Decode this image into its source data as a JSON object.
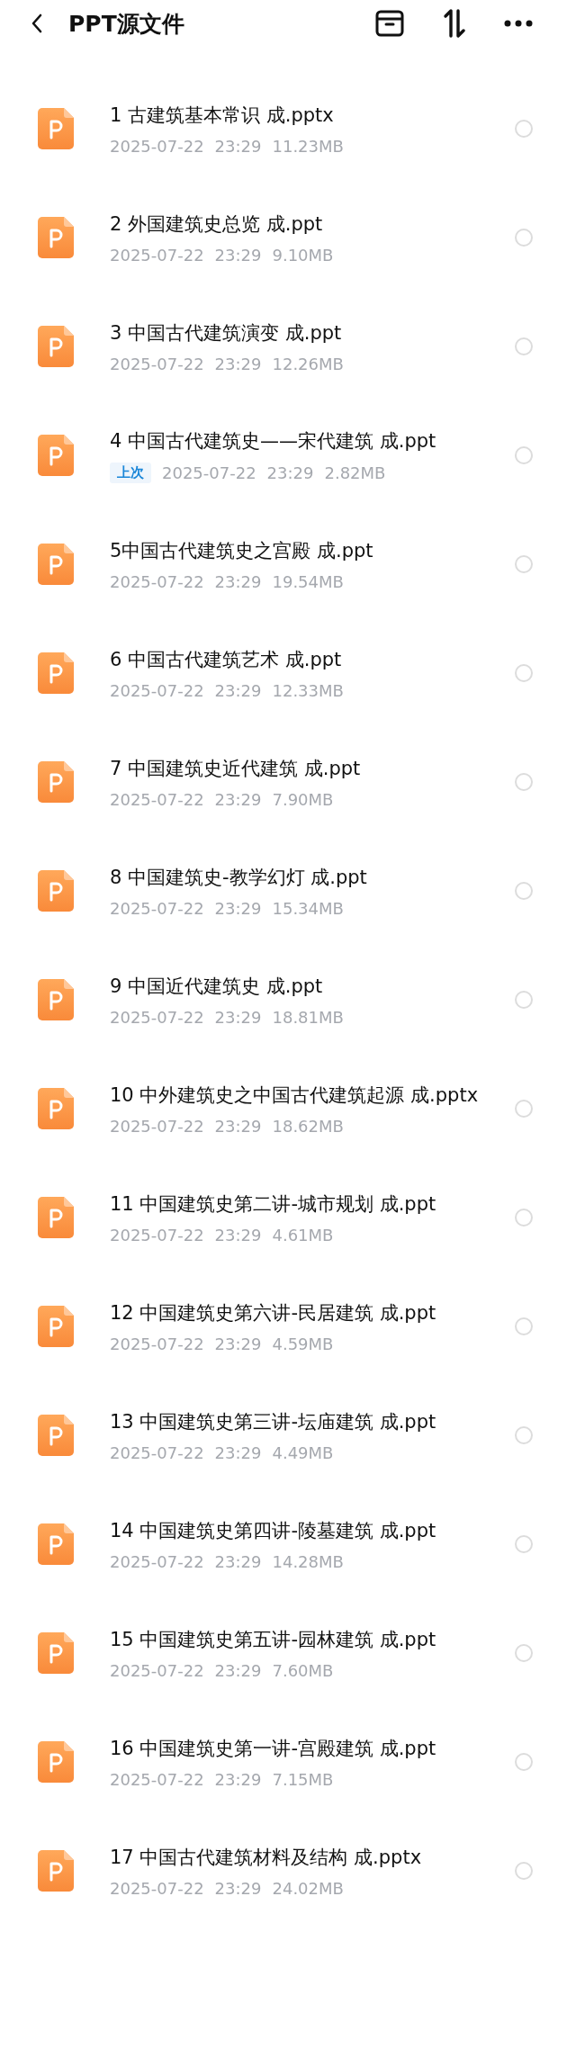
{
  "header": {
    "title": "PPT源文件"
  },
  "files": [
    {
      "name": "1 古建筑基本常识 成.pptx",
      "date": "2025-07-22",
      "time": "23:29",
      "size": "11.23MB",
      "selected": false
    },
    {
      "name": "2 外国建筑史总览 成.ppt",
      "date": "2025-07-22",
      "time": "23:29",
      "size": "9.10MB",
      "selected": false
    },
    {
      "name": "3 中国古代建筑演变 成.ppt",
      "date": "2025-07-22",
      "time": "23:29",
      "size": "12.26MB",
      "selected": false
    },
    {
      "name": "4 中国古代建筑史——宋代建筑 成.ppt",
      "badge": "上次",
      "date": "2025-07-22",
      "time": "23:29",
      "size": "2.82MB",
      "selected": false
    },
    {
      "name": "5中国古代建筑史之宫殿 成.ppt",
      "date": "2025-07-22",
      "time": "23:29",
      "size": "19.54MB",
      "selected": false
    },
    {
      "name": "6 中国古代建筑艺术 成.ppt",
      "date": "2025-07-22",
      "time": "23:29",
      "size": "12.33MB",
      "selected": false
    },
    {
      "name": "7 中国建筑史近代建筑 成.ppt",
      "date": "2025-07-22",
      "time": "23:29",
      "size": "7.90MB",
      "selected": false
    },
    {
      "name": "8 中国建筑史-教学幻灯 成.ppt",
      "date": "2025-07-22",
      "time": "23:29",
      "size": "15.34MB",
      "selected": false
    },
    {
      "name": "9 中国近代建筑史 成.ppt",
      "date": "2025-07-22",
      "time": "23:29",
      "size": "18.81MB",
      "selected": false
    },
    {
      "name": "10 中外建筑史之中国古代建筑起源 成.pptx",
      "date": "2025-07-22",
      "time": "23:29",
      "size": "18.62MB",
      "selected": false
    },
    {
      "name": "11 中国建筑史第二讲-城市规划 成.ppt",
      "date": "2025-07-22",
      "time": "23:29",
      "size": "4.61MB",
      "selected": false
    },
    {
      "name": "12 中国建筑史第六讲-民居建筑 成.ppt",
      "date": "2025-07-22",
      "time": "23:29",
      "size": "4.59MB",
      "selected": false
    },
    {
      "name": "13 中国建筑史第三讲-坛庙建筑 成.ppt",
      "date": "2025-07-22",
      "time": "23:29",
      "size": "4.49MB",
      "selected": false
    },
    {
      "name": "14 中国建筑史第四讲-陵墓建筑 成.ppt",
      "date": "2025-07-22",
      "time": "23:29",
      "size": "14.28MB",
      "selected": false
    },
    {
      "name": "15 中国建筑史第五讲-园林建筑 成.ppt",
      "date": "2025-07-22",
      "time": "23:29",
      "size": "7.60MB",
      "selected": false
    },
    {
      "name": "16 中国建筑史第一讲-宫殿建筑 成.ppt",
      "date": "2025-07-22",
      "time": "23:29",
      "size": "7.15MB",
      "selected": false
    },
    {
      "name": "17 中国古代建筑材料及结构 成.pptx",
      "date": "2025-07-22",
      "time": "23:29",
      "size": "24.02MB",
      "selected": false
    }
  ]
}
